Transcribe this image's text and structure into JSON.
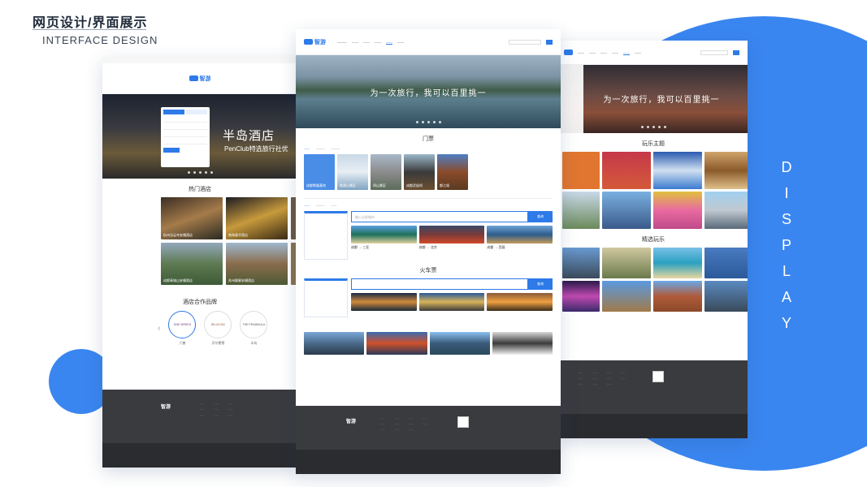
{
  "header": {
    "title": "网页设计/界面展示",
    "subtitle": "INTERFACE DESIGN"
  },
  "side_label": "DISPLAY",
  "caption": "推荐",
  "brand_name": "智游",
  "colors": {
    "accent": "#3a86f0",
    "footer": "#3a3b3f"
  },
  "left_page": {
    "hero_title": "半岛酒店",
    "hero_subtitle": "PenClub特选旅行社优",
    "section_hot": "热门酒店",
    "hotels": [
      {
        "name": "杭州法云寺安缦酒店"
      },
      {
        "name": "南海泰华酒店"
      },
      {
        "name": "成都青城山安缦酒店"
      },
      {
        "name": "苏州柳廊安缦酒店"
      }
    ],
    "section_brand": "酒店合作品牌",
    "brands": [
      {
        "logo": "ONE SERIES",
        "name": "六善"
      },
      {
        "logo": "BELMOND",
        "name": "贝尔蒙德"
      },
      {
        "logo": "THE PENINSULA",
        "name": "半岛"
      }
    ]
  },
  "mid_page": {
    "hero_caption": "为一次旅行，我可以百里挑一",
    "section_tickets": "门票",
    "ticket_tiles": [
      "成都熊猫基地",
      "桃源山景区",
      "四山景区",
      "成都武侯祠",
      "都江堰"
    ],
    "search_placeholder": "输入出发城市",
    "search_button": "查询",
    "section_train": "火车票",
    "routes": [
      {
        "from": "成都",
        "to": "三亚"
      },
      {
        "from": "成都",
        "to": "北京"
      },
      {
        "from": "成都",
        "to": "西昌"
      }
    ]
  },
  "right_page": {
    "hero_caption": "为一次旅行，我可以百里挑一",
    "section_theme": "玩乐主题",
    "section_select": "精选玩乐"
  }
}
